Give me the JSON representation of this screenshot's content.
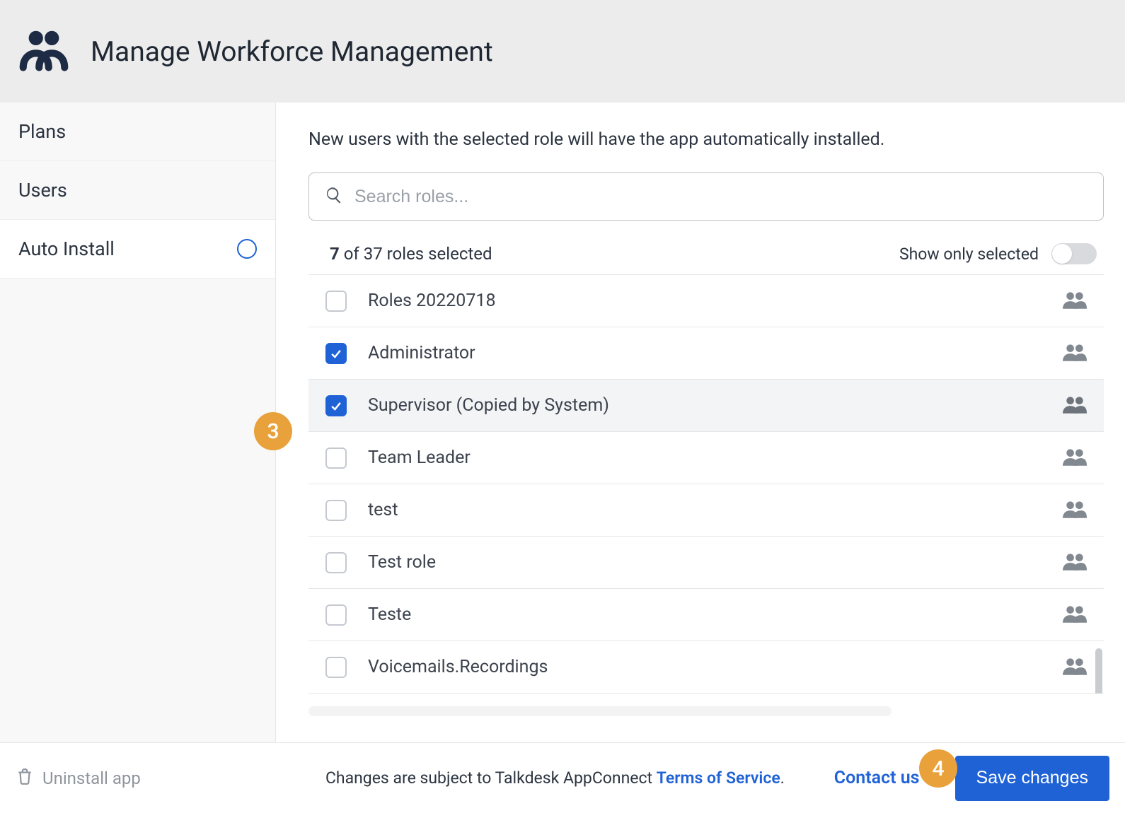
{
  "header": {
    "title": "Manage Workforce Management"
  },
  "sidebar": {
    "items": [
      {
        "label": "Plans"
      },
      {
        "label": "Users"
      },
      {
        "label": "Auto Install"
      }
    ]
  },
  "main": {
    "intro": "New users with the selected role will have the app automatically installed.",
    "search_placeholder": "Search roles...",
    "selected_count": "7",
    "total_count": "37",
    "count_prefix_of": " of ",
    "count_suffix": " roles selected",
    "show_only_selected_label": "Show only selected",
    "roles": [
      {
        "label": "Roles 20220718",
        "checked": false,
        "highlight": false
      },
      {
        "label": "Administrator",
        "checked": true,
        "highlight": false
      },
      {
        "label": "Supervisor (Copied by System)",
        "checked": true,
        "highlight": true
      },
      {
        "label": "Team Leader",
        "checked": false,
        "highlight": false
      },
      {
        "label": "test",
        "checked": false,
        "highlight": false
      },
      {
        "label": "Test role",
        "checked": false,
        "highlight": false
      },
      {
        "label": "Teste",
        "checked": false,
        "highlight": false
      },
      {
        "label": "Voicemails.Recordings",
        "checked": false,
        "highlight": false
      }
    ]
  },
  "footer": {
    "uninstall_label": "Uninstall app",
    "terms_prefix": "Changes are subject to Talkdesk AppConnect ",
    "terms_link": "Terms of Service",
    "terms_suffix": ".",
    "contact_label": "Contact us",
    "save_label": "Save changes"
  },
  "callouts": {
    "c3": "3",
    "c4": "4"
  }
}
